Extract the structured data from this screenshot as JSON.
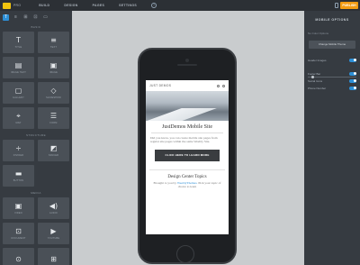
{
  "topbar": {
    "app_label": "PRO",
    "nav": [
      "BUILD",
      "DESIGN",
      "PAGES",
      "SETTINGS"
    ],
    "help_glyph": "?",
    "publish_label": "PUBLISH"
  },
  "left_panel": {
    "tab_glyphs": [
      "T",
      "≡",
      "⊞",
      "⊡",
      "▭"
    ],
    "sections": {
      "basic": "BASIC",
      "structure": "STRUCTURE",
      "media": "MEDIA"
    },
    "basic_items": [
      {
        "glyph": "T",
        "label": "TITLE"
      },
      {
        "glyph": "≡",
        "label": "TEXT"
      },
      {
        "glyph": "▤",
        "label": "IMAGE TEXT"
      },
      {
        "glyph": "▣",
        "label": "IMAGE"
      },
      {
        "glyph": "▢",
        "label": "GALLERY"
      },
      {
        "glyph": "◇",
        "label": "SLIDESHOW"
      },
      {
        "glyph": "⌖",
        "label": "MAP"
      },
      {
        "glyph": "☰",
        "label": "FORM"
      }
    ],
    "structure_items": [
      {
        "glyph": "÷",
        "label": "DIVIDER"
      },
      {
        "glyph": "◩",
        "label": "SPACER"
      },
      {
        "glyph": "▬",
        "label": "BUTTON"
      }
    ],
    "media_items": [
      {
        "glyph": "▣",
        "label": "VIDEO"
      },
      {
        "glyph": "◀)",
        "label": "AUDIO"
      },
      {
        "glyph": "⊡",
        "label": "DOCUMENT"
      },
      {
        "glyph": "▶",
        "label": "YOUTUBE"
      },
      {
        "glyph": "⊙",
        "label": ""
      },
      {
        "glyph": "⊞",
        "label": ""
      }
    ]
  },
  "phone_screen": {
    "brand": "JUST DEMOS",
    "title": "JustDemos Mobile Site",
    "body": "Did you know, you can create mobile site pages from regular site pages within the same Weebly Site.",
    "button": "CLICK HERE TO LEARN MORE",
    "topic_title": "Design Center Topics",
    "topic_body_pre": "Brought to you by ",
    "topic_link": "WeeblyThemes.",
    "topic_body_post": " Pick your topic of choice to learn"
  },
  "right_panel": {
    "title": "MOBILE OPTIONS",
    "color_options_label": "No Color Options",
    "change_theme_button": "Change Mobile Theme",
    "options": [
      {
        "label": "Header Images",
        "toggle": true
      },
      {
        "label": "Footer Bar",
        "toggle": true
      },
      {
        "label": "Social Icons",
        "toggle": true
      },
      {
        "label": "Phone Number",
        "toggle": true
      }
    ],
    "slider_label": "Scroll Size"
  },
  "colors": {
    "accent": "#2d8fd6",
    "publish": "#f39c12",
    "panel": "#363b41"
  }
}
